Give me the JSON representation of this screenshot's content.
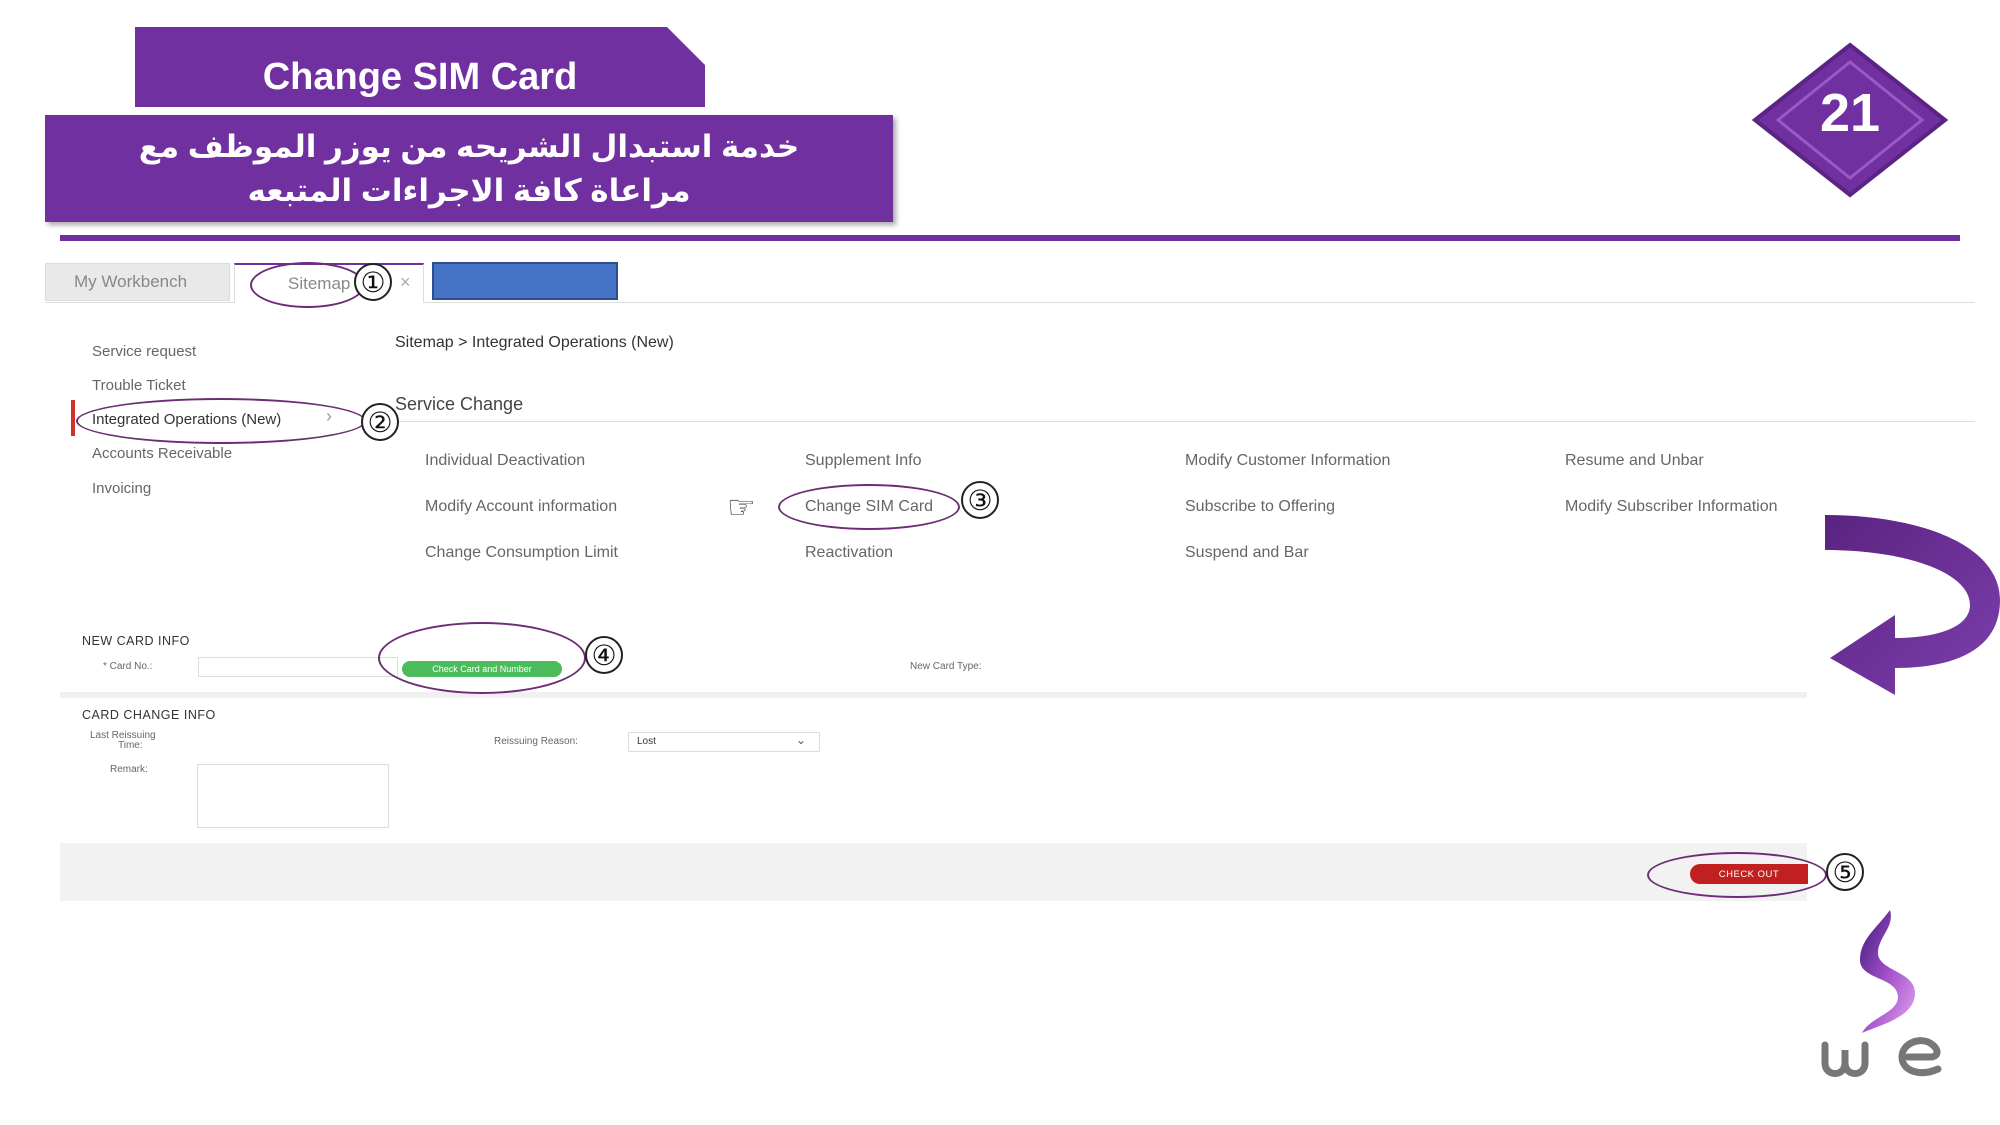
{
  "slide": {
    "title": "Change SIM Card",
    "subtitle_ar": "خدمة استبدال الشريحه من يوزر الموظف مع مراعاة كافة الاجراءات المتبعه",
    "page_number": "21"
  },
  "tabs": {
    "workbench": "My Workbench",
    "sitemap": "Sitemap",
    "close": "×"
  },
  "menu": {
    "items": [
      "Service request",
      "Trouble Ticket",
      "Integrated Operations (New)",
      "Accounts Receivable",
      "Invoicing"
    ]
  },
  "breadcrumb": "Sitemap > Integrated Operations (New)",
  "section": {
    "title": "Service Change",
    "operations": [
      [
        "Individual Deactivation",
        "Supplement Info",
        "Modify Customer Information",
        "Resume and Unbar"
      ],
      [
        "Modify Account information",
        "Change SIM Card",
        "Subscribe to Offering",
        "Modify Subscriber Information"
      ],
      [
        "Change Consumption Limit",
        "Reactivation",
        "Suspend and Bar",
        ""
      ]
    ]
  },
  "form": {
    "new_card_header": "NEW CARD INFO",
    "card_no_label": "* Card No.:",
    "check_button": "Check Card and Number",
    "new_card_type_label": "New Card Type:",
    "card_change_header": "CARD CHANGE INFO",
    "last_reissuing_label_1": "Last Reissuing",
    "last_reissuing_label_2": "Time:",
    "reissuing_reason_label": "Reissuing Reason:",
    "reissuing_reason_value": "Lost",
    "remark_label": "Remark:",
    "checkout_button": "CHECK OUT"
  },
  "steps": [
    "①",
    "②",
    "③",
    "④",
    "⑤"
  ],
  "icons": {
    "pointer": "☞"
  },
  "colors": {
    "brand_purple": "#7030a0",
    "active_red": "#d0312d",
    "check_green": "#4cbb5c",
    "checkout_red": "#c0201f",
    "blank_tab_blue": "#4472c4"
  }
}
